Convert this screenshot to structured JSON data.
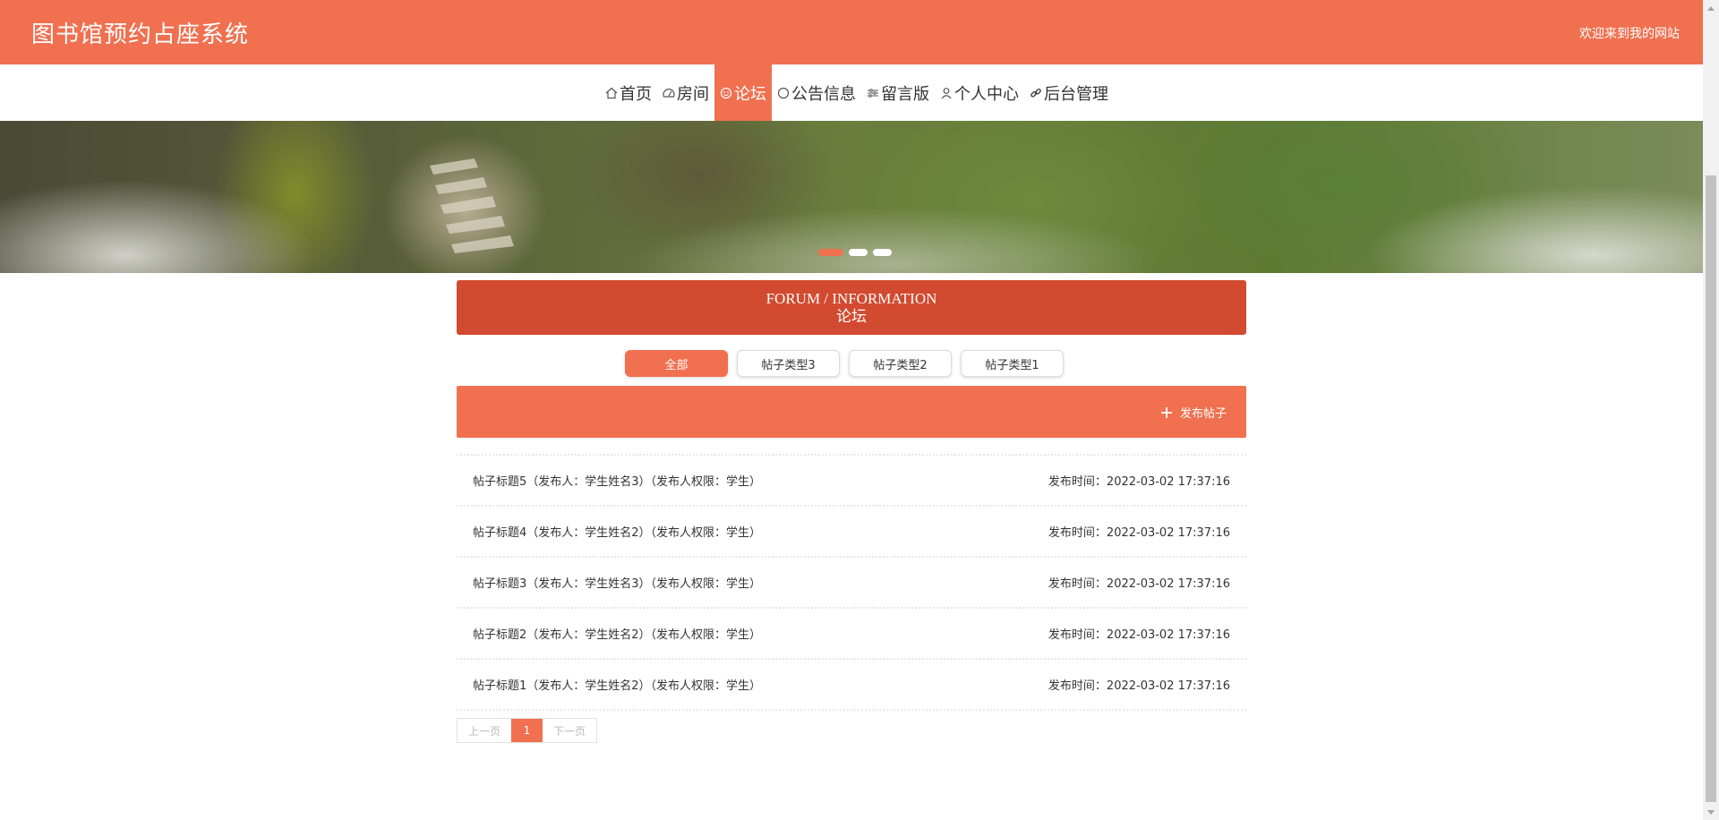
{
  "header": {
    "site_title": "图书馆预约占座系统",
    "welcome": "欢迎来到我的网站"
  },
  "nav": {
    "items": [
      {
        "label": "首页",
        "icon": "home-icon"
      },
      {
        "label": "房间",
        "icon": "gauge-icon"
      },
      {
        "label": "论坛",
        "icon": "forum-icon",
        "active": true
      },
      {
        "label": "公告信息",
        "icon": "circle-icon"
      },
      {
        "label": "留言版",
        "icon": "sliders-icon"
      },
      {
        "label": "个人中心",
        "icon": "user-icon"
      },
      {
        "label": "后台管理",
        "icon": "link-icon"
      }
    ]
  },
  "carousel": {
    "slides": 3,
    "active_index": 0
  },
  "section": {
    "title_en": "FORUM / INFORMATION",
    "title_zh": "论坛"
  },
  "categories": [
    {
      "label": "全部",
      "active": true
    },
    {
      "label": "帖子类型3"
    },
    {
      "label": "帖子类型2"
    },
    {
      "label": "帖子类型1"
    }
  ],
  "post_button": {
    "label": "发布帖子",
    "icon": "plus-icon"
  },
  "posts": [
    {
      "title": "帖子标题5（发布人：学生姓名3）（发布人权限：学生）",
      "time": "发布时间：2022-03-02 17:37:16"
    },
    {
      "title": "帖子标题4（发布人：学生姓名2）（发布人权限：学生）",
      "time": "发布时间：2022-03-02 17:37:16"
    },
    {
      "title": "帖子标题3（发布人：学生姓名3）（发布人权限：学生）",
      "time": "发布时间：2022-03-02 17:37:16"
    },
    {
      "title": "帖子标题2（发布人：学生姓名2）（发布人权限：学生）",
      "time": "发布时间：2022-03-02 17:37:16"
    },
    {
      "title": "帖子标题1（发布人：学生姓名2）（发布人权限：学生）",
      "time": "发布时间：2022-03-02 17:37:16"
    }
  ],
  "pager": {
    "prev": "上一页",
    "current": "1",
    "next": "下一页"
  },
  "colors": {
    "primary": "#f07050",
    "section_head": "#d24a2f"
  }
}
